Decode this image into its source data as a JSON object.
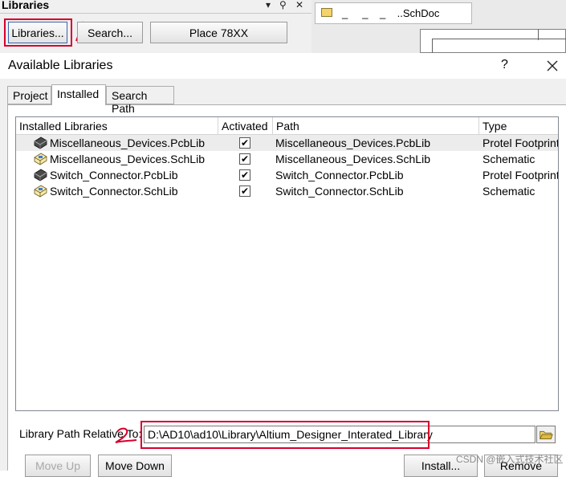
{
  "panel": {
    "title": "Libraries",
    "controls": [
      "▾",
      "⚲",
      "✕"
    ],
    "buttons": {
      "libraries": "Libraries...",
      "search": "Search...",
      "place": "Place 78XX"
    }
  },
  "document": {
    "tab_label": "_     _    _    ..SchDoc"
  },
  "dialog": {
    "title": "Available Libraries",
    "help": "?",
    "tabs": [
      "Project",
      "Installed",
      "Search Path"
    ],
    "active_tab": "Installed",
    "columns": [
      "Installed Libraries",
      "Activated",
      "Path",
      "Type"
    ],
    "rows": [
      {
        "icon": "pcb-library-icon",
        "name": "Miscellaneous_Devices.PcbLib",
        "activated": "✔",
        "path": "Miscellaneous_Devices.PcbLib",
        "type": "Protel Footprint"
      },
      {
        "icon": "sch-library-icon",
        "name": "Miscellaneous_Devices.SchLib",
        "activated": "✔",
        "path": "Miscellaneous_Devices.SchLib",
        "type": "Schematic"
      },
      {
        "icon": "pcb-library-icon",
        "name": "Switch_Connector.PcbLib",
        "activated": "✔",
        "path": "Switch_Connector.PcbLib",
        "type": "Protel Footprint"
      },
      {
        "icon": "sch-library-icon",
        "name": "Switch_Connector.SchLib",
        "activated": "✔",
        "path": "Switch_Connector.SchLib",
        "type": "Schematic"
      }
    ],
    "path_label": "Library Path Relative To:",
    "path_value": "D:\\AD10\\ad10\\Library\\Altium_Designer_Interated_Library",
    "buttons": {
      "move_up": "Move Up",
      "move_down": "Move Down",
      "install": "Install...",
      "remove": "Remove"
    }
  },
  "watermark": "CSDN @嵌入式技术社区",
  "colors": {
    "annotation_red": "#d7002c",
    "selection_blue": "#3c62a8",
    "folder_yellow": "#f3d36a"
  }
}
